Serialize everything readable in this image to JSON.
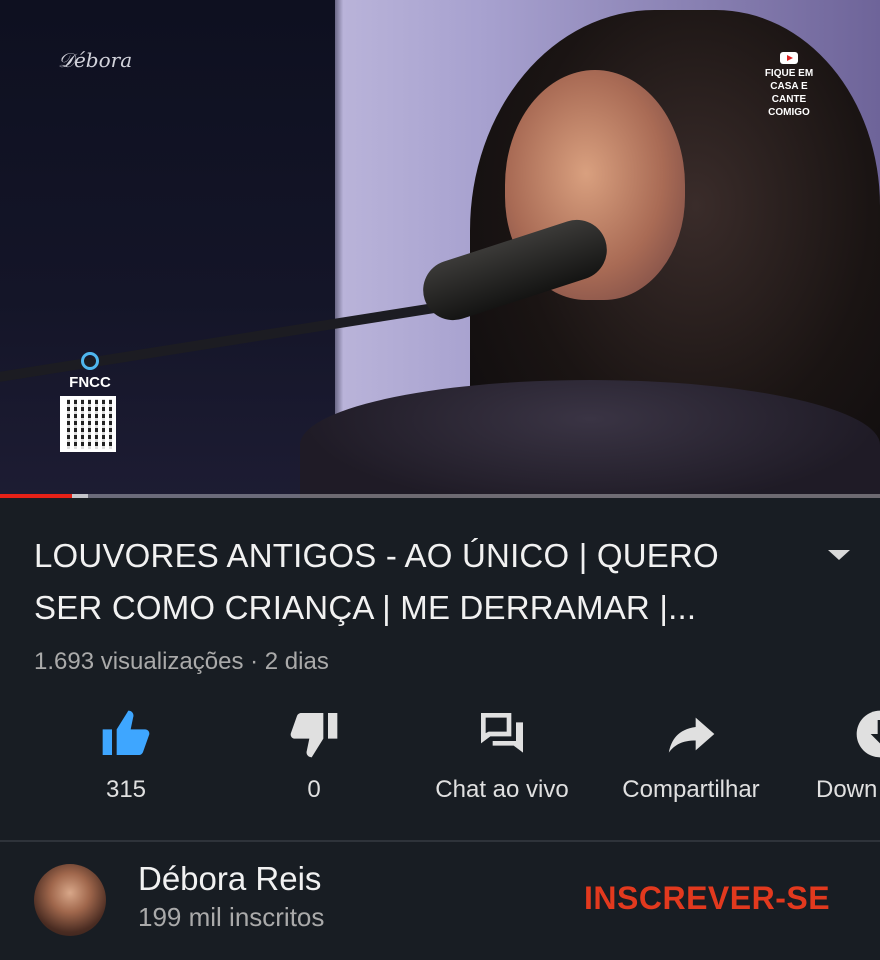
{
  "player": {
    "channel_logo_text": "Débora Reis",
    "overlay_badge_text": "FIQUE EM CASA E CANTE COMIGO",
    "sponsor_label": "FNCC",
    "progress": {
      "played_fraction": 0.082,
      "buffered_fraction": 0.1
    }
  },
  "video": {
    "title_line1": "LOUVORES ANTIGOS - AO ÚNICO | QUERO",
    "title_line2": "SER COMO CRIANÇA | ME DERRAMAR |...",
    "meta": "1.693 visualizações · 2 dias"
  },
  "actions": {
    "like": {
      "icon": "thumbs-up-icon",
      "label": "315",
      "color": "#3ea6ff"
    },
    "dislike": {
      "icon": "thumbs-down-icon",
      "label": "0"
    },
    "live_chat": {
      "icon": "chat-icon",
      "label": "Chat ao vivo"
    },
    "share": {
      "icon": "share-icon",
      "label": "Compartilhar"
    },
    "download": {
      "icon": "download-icon",
      "label": "Down"
    }
  },
  "channel": {
    "name": "Débora Reis",
    "subscribers": "199 mil inscritos",
    "subscribe_label": "INSCREVER-SE",
    "subscribe_color": "#e2391e"
  }
}
